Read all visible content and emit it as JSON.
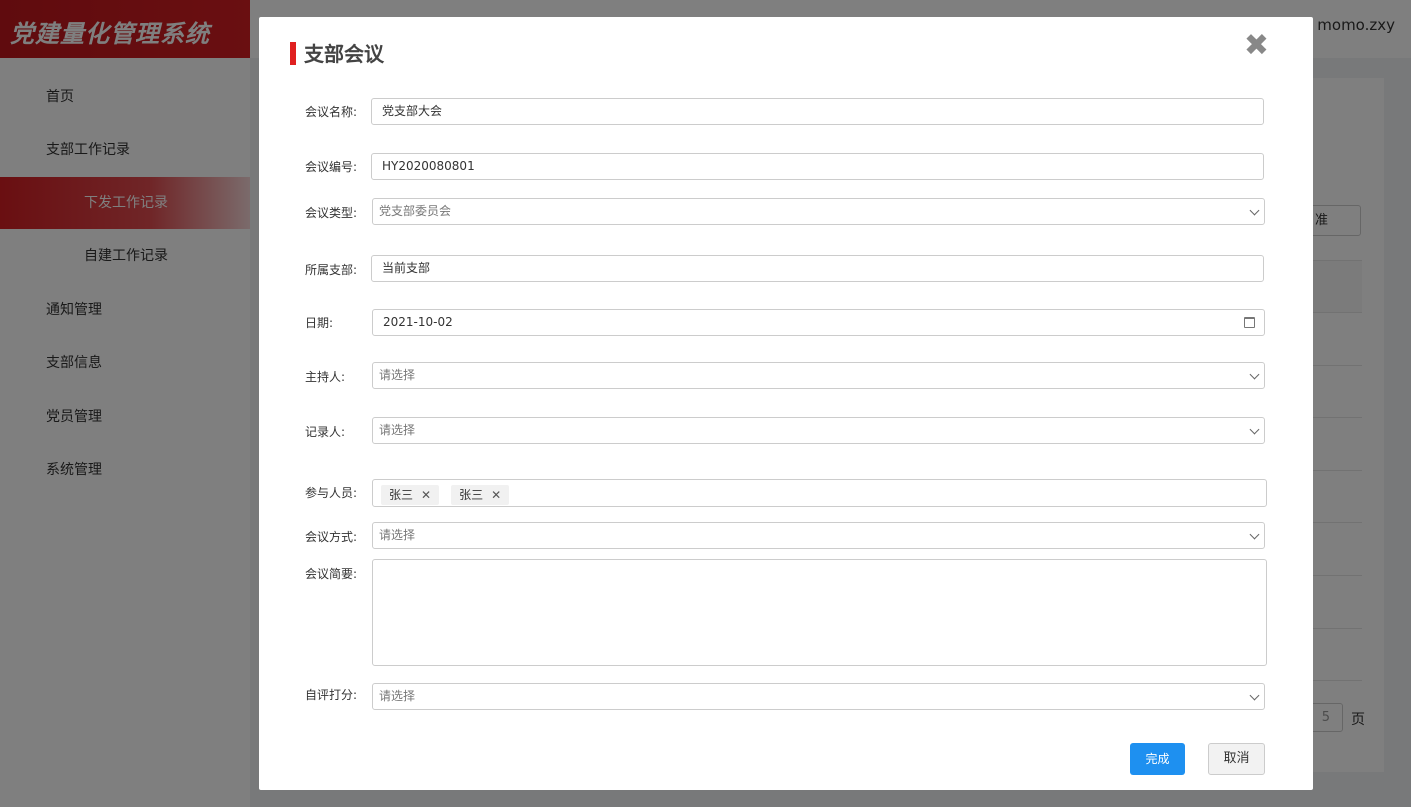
{
  "app": {
    "brand": "党建量化管理系统",
    "user": "momo.zxy"
  },
  "sidebar": {
    "items": [
      {
        "label": "首页"
      },
      {
        "label": "支部工作记录"
      },
      {
        "label": "下发工作记录"
      },
      {
        "label": "自建工作记录"
      },
      {
        "label": "通知管理"
      },
      {
        "label": "支部信息"
      },
      {
        "label": "党员管理"
      },
      {
        "label": "系统管理"
      }
    ]
  },
  "background": {
    "button_fragment": "准",
    "pager_value": "5",
    "pager_label": "页"
  },
  "modal": {
    "title": "支部会议",
    "fields": {
      "name": {
        "label": "会议名称:",
        "value": "党支部大会"
      },
      "number": {
        "label": "会议编号:",
        "value": "HY2020080801"
      },
      "type": {
        "label": "会议类型:",
        "value": "党支部委员会"
      },
      "branch": {
        "label": "所属支部:",
        "value": "当前支部"
      },
      "date": {
        "label": "日期:",
        "value": "2021-10-02"
      },
      "host": {
        "label": "主持人:",
        "value": "请选择"
      },
      "recorder": {
        "label": "记录人:",
        "value": "请选择"
      },
      "participants": {
        "label": "参与人员:",
        "tags": [
          "张三",
          "张三"
        ]
      },
      "method": {
        "label": "会议方式:",
        "value": "请选择"
      },
      "summary": {
        "label": "会议简要:",
        "value": ""
      },
      "score": {
        "label": "自评打分:",
        "value": "请选择"
      }
    },
    "buttons": {
      "confirm": "完成",
      "cancel": "取消"
    }
  }
}
